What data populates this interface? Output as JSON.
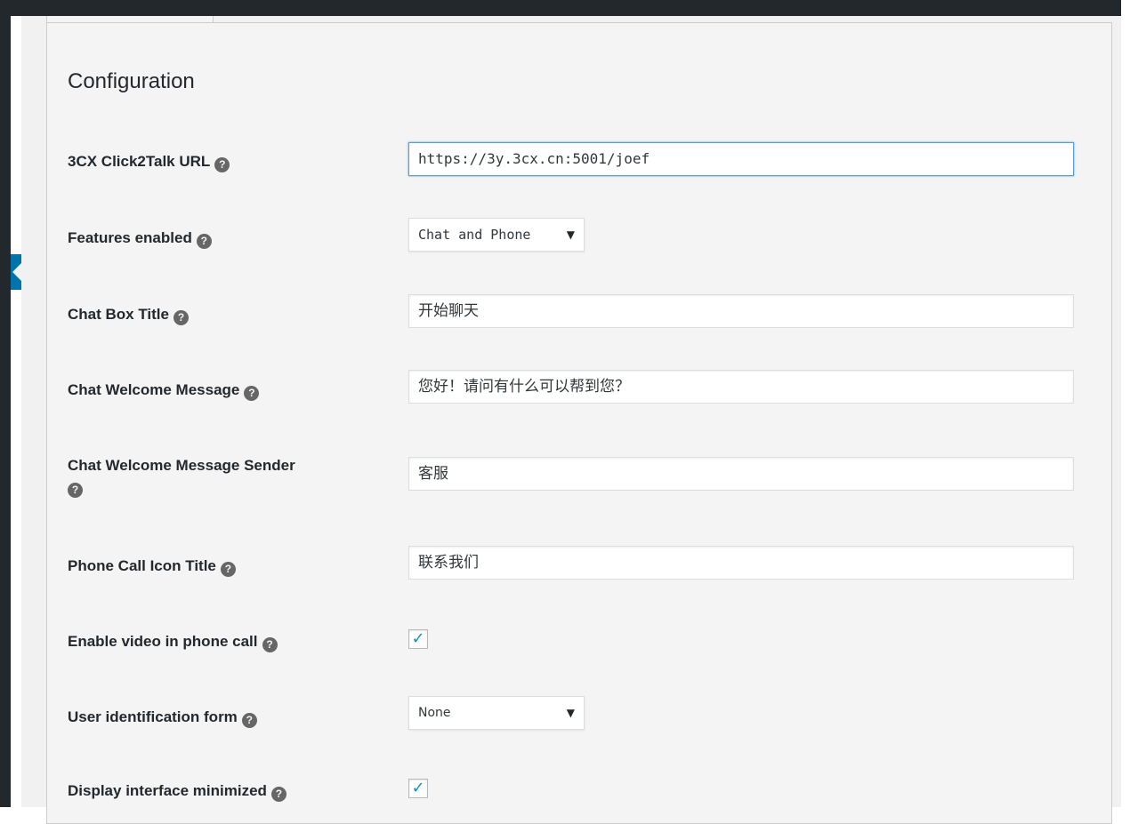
{
  "section_title": "Configuration",
  "help_glyph": "?",
  "fields": {
    "click2talk_url": {
      "label": "3CX Click2Talk URL",
      "value": "https://3y.3cx.cn:5001/joef"
    },
    "features_enabled": {
      "label": "Features enabled",
      "selected": "Chat and Phone"
    },
    "chat_box_title": {
      "label": "Chat Box Title",
      "value": "开始聊天"
    },
    "chat_welcome_message": {
      "label": "Chat Welcome Message",
      "value": "您好！请问有什么可以帮到您？"
    },
    "chat_welcome_sender": {
      "label": "Chat Welcome Message Sender",
      "value": "客服"
    },
    "phone_call_icon_title": {
      "label": "Phone Call Icon Title",
      "value": "联系我们"
    },
    "enable_video": {
      "label": "Enable video in phone call",
      "checked": true
    },
    "user_identification_form": {
      "label": "User identification form",
      "selected": "None"
    },
    "display_minimized": {
      "label": "Display interface minimized",
      "checked": true
    }
  },
  "checkmark_glyph": "✓",
  "caret_glyph": "▼",
  "colors": {
    "accent": "#0073aa",
    "focus_border": "#5b9dd9",
    "check": "#1e8cbe"
  }
}
